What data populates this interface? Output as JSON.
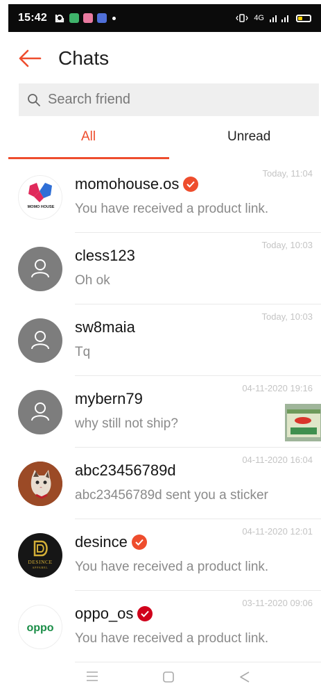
{
  "status_bar": {
    "time": "15:42",
    "network_text": "4G"
  },
  "header": {
    "title": "Chats"
  },
  "search": {
    "placeholder": "Search friend"
  },
  "tabs": [
    {
      "label": "All",
      "active": true
    },
    {
      "label": "Unread",
      "active": false
    }
  ],
  "colors": {
    "accent": "#ee4d2d",
    "verified": "#ee4d2d",
    "official": "#d0011b"
  },
  "chats": [
    {
      "name": "momohouse.os",
      "message": "You have received a product link.",
      "time": "Today, 11:04",
      "avatar": "momohouse-logo",
      "avatar_text": "MOMO HOUSE",
      "badge": "verified-icon"
    },
    {
      "name": "cless123",
      "message": "Oh ok",
      "time": "Today, 10:03",
      "avatar": "default-user-icon"
    },
    {
      "name": "sw8maia",
      "message": "Tq",
      "time": "Today, 10:03",
      "avatar": "default-user-icon"
    },
    {
      "name": "mybern79",
      "message": "why still not ship?",
      "time": "04-11-2020 19:16",
      "avatar": "default-user-icon",
      "thumbnail": "product-box-image"
    },
    {
      "name": "abc23456789d",
      "message": "abc23456789d sent you a sticker",
      "time": "04-11-2020 16:04",
      "avatar": "cat-photo"
    },
    {
      "name": "desince",
      "message": "You have received a product link.",
      "time": "04-11-2020 12:01",
      "avatar": "desince-logo",
      "avatar_text": "DESINCE",
      "avatar_subtext": "APPAREL",
      "badge": "verified-icon"
    },
    {
      "name": "oppo_os",
      "message": "You have received a product link.",
      "time": "03-11-2020 09:06",
      "avatar": "oppo-logo",
      "avatar_text": "oppo",
      "badge": "official-icon"
    }
  ]
}
